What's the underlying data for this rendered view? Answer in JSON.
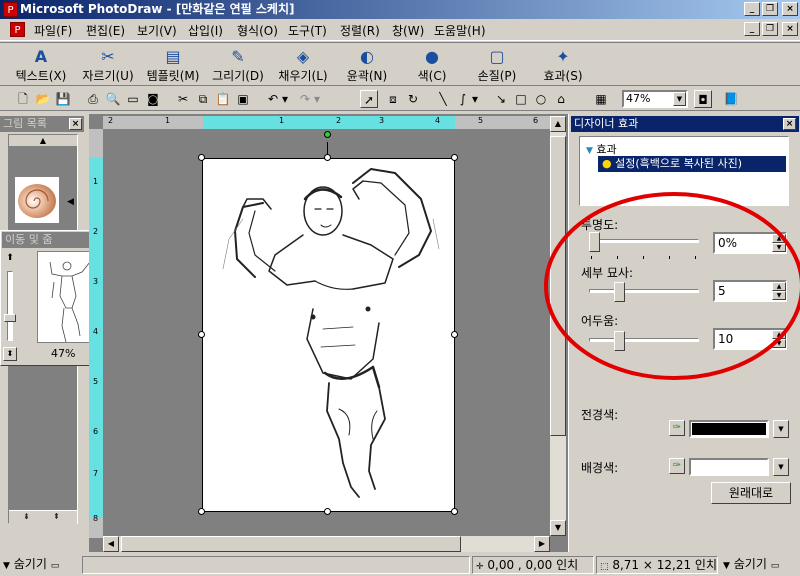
{
  "window": {
    "title": "Microsoft PhotoDraw - [만화같은 연필 스케치]"
  },
  "menu": [
    "파일(F)",
    "편집(E)",
    "보기(V)",
    "삽입(I)",
    "형식(O)",
    "도구(T)",
    "정렬(R)",
    "창(W)",
    "도움말(H)"
  ],
  "bigtools": [
    "텍스트(X)",
    "자르기(U)",
    "템플릿(M)",
    "그리기(D)",
    "채우기(L)",
    "윤곽(N)",
    "색(C)",
    "손질(P)",
    "효과(S)"
  ],
  "toolbar": {
    "zoom": "47%"
  },
  "gallery": {
    "title": "그림 목록"
  },
  "nav": {
    "title": "이동 및 줌",
    "zoom": "47%"
  },
  "ruler": {
    "h": [
      "2",
      "1",
      "1",
      "2",
      "3",
      "4",
      "5",
      "6"
    ],
    "v": [
      "1",
      "2",
      "3",
      "4",
      "5",
      "6",
      "7",
      "8"
    ]
  },
  "designer": {
    "title": "디자이너 효과",
    "tree_root": "효과",
    "tree_item": "설정(흑백으로 복사된 사진)",
    "opacity_label": "투명도:",
    "opacity_value": "0%",
    "opacity_level": 0,
    "detail_label": "세부 묘사:",
    "detail_value": "5",
    "detail_level": 5,
    "dark_label": "어두움:",
    "dark_value": "10",
    "dark_level": 10,
    "fg_label": "전경색:",
    "fg_color": "#000000",
    "bg_label": "배경색:",
    "bg_color": "#ffffff",
    "reset_label": "원래대로"
  },
  "status": {
    "hide_left": "숨기기",
    "coords": "0,00 , 0,00 인치",
    "size": "8,71 × 12,21 인치",
    "hide_right": "숨기기"
  },
  "colors": {
    "accent": "#0a246a",
    "ruler_highlight": "#66e0e0",
    "highlight_circle": "#e00000"
  }
}
